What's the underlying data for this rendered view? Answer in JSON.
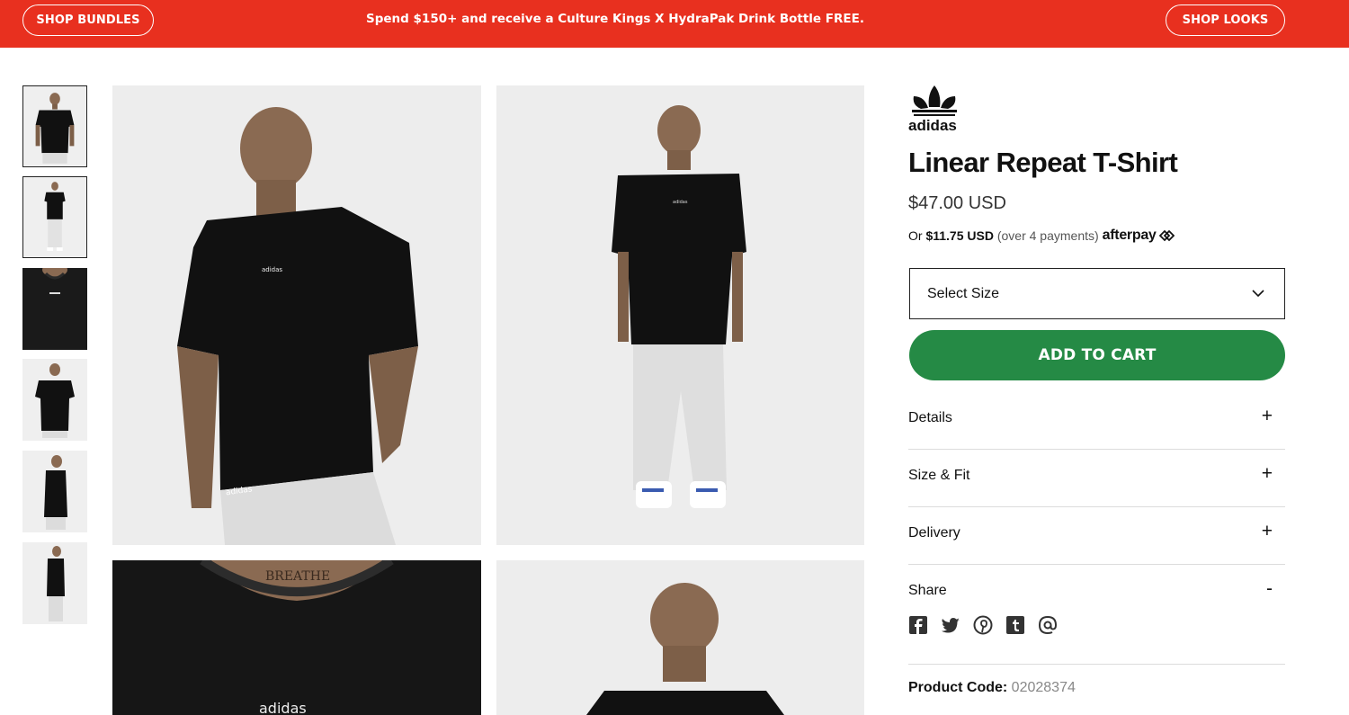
{
  "banner": {
    "left_button": "SHOP BUNDLES",
    "promo": "Spend $150+ and receive a Culture Kings X HydraPak Drink Bottle FREE.",
    "right_button": "SHOP LOOKS",
    "color": "#e8301f"
  },
  "gallery": {
    "thumbnails": [
      {
        "view": "front-closeup",
        "selected": true
      },
      {
        "view": "front-full",
        "selected": true
      },
      {
        "view": "chest-detail",
        "selected": false
      },
      {
        "view": "back",
        "selected": false
      },
      {
        "view": "side",
        "selected": false
      },
      {
        "view": "side-full",
        "selected": false
      }
    ],
    "main_images": [
      "front-closeup",
      "front-full",
      "neck-detail",
      "back-full"
    ],
    "shirt_print": "adidas",
    "neck_tattoo": "BREATHE"
  },
  "product": {
    "brand": "adidas",
    "title": "Linear Repeat T-Shirt",
    "price": "$47.00 USD",
    "afterpay": {
      "prefix": "Or",
      "amount": "$11.75 USD",
      "detail": "(over 4 payments)",
      "logo": "afterpay"
    },
    "size_select": {
      "placeholder": "Select Size"
    },
    "add_to_cart": "ADD TO CART",
    "add_to_cart_color": "#258a45",
    "accordions": [
      {
        "label": "Details",
        "sign": "+"
      },
      {
        "label": "Size & Fit",
        "sign": "+"
      },
      {
        "label": "Delivery",
        "sign": "+"
      },
      {
        "label": "Share",
        "sign": "-"
      }
    ],
    "share_icons": [
      "facebook-icon",
      "twitter-icon",
      "pinterest-icon",
      "tumblr-icon",
      "email-icon"
    ],
    "code_label": "Product Code:",
    "code_value": "02028374"
  }
}
